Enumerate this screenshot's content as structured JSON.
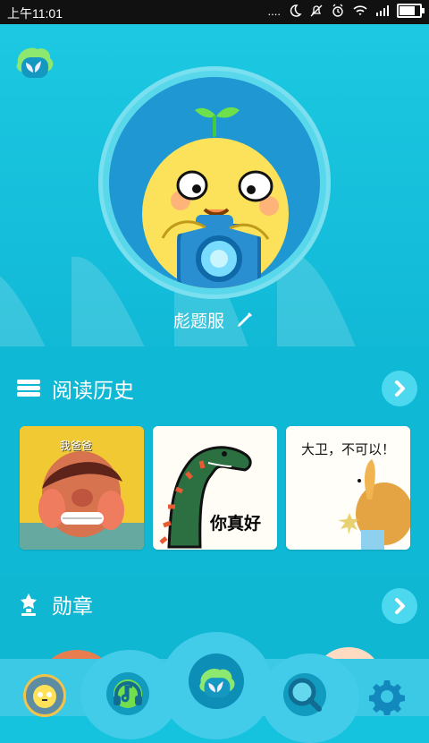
{
  "status_bar": {
    "time": "上午11:01",
    "signal_label": "....",
    "battery_percent": 85
  },
  "profile": {
    "name": "彪题服"
  },
  "reading_history": {
    "title": "阅读历史",
    "books": [
      {
        "title": "我爸爸"
      },
      {
        "title": "你真好"
      },
      {
        "title": "大卫，不可以！"
      }
    ]
  },
  "medals": {
    "title": "勋章"
  },
  "bottom_nav": {
    "items": [
      "profile-tab",
      "music-tab",
      "home-tab",
      "search-tab",
      "settings-tab"
    ]
  },
  "colors": {
    "accent": "#17c3de",
    "button": "#4cd8ef",
    "dark_nav": "#119fc4"
  }
}
